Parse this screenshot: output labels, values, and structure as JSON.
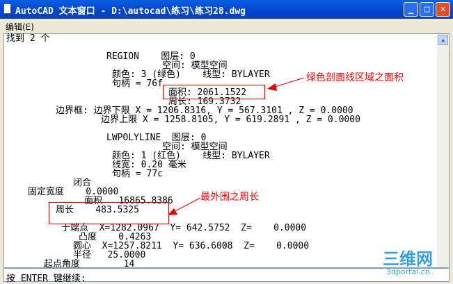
{
  "window": {
    "title": "AutoCAD 文本窗口 - D:\\autocad\\练习\\练习28.dwg",
    "minimize": "_",
    "maximize": "□",
    "close": "✕"
  },
  "menu": {
    "edit": "编辑(E)"
  },
  "lines": [
    "找到 2 个",
    "REGION    图层: 0",
    "空间: 模型空间",
    "颜色: 3 (绿色)    线型: BYLAYER",
    "句柄 = 76f",
    "面积: 2061.1522",
    "周长: 169.3732",
    "边界框: 边界下限 X = 1206.8316, Y = 567.3101 , Z = 0.0000",
    "边界上限 X = 1258.8105, Y = 619.2891 , Z = 0.0000",
    "LWPOLYLINE  图层: 0",
    "空间: 模型空间",
    "颜色: 1 (红色)    线型: BYLAYER",
    "线宽: 0.20 毫米",
    "句柄 = 77c",
    "闭合",
    "固定宽度    0.0000",
    "面积   16865.8386",
    "周长    483.5325",
    "于端点  X=1282.0967  Y= 642.5752  Z=    0.0000",
    "凸度    0.4263",
    "圆心  X=1257.8211  Y= 636.6008  Z=    0.0000",
    "半径   25.0000",
    "起点角度        14"
  ],
  "prompt": "按 ENTER 键继续:",
  "annotations": {
    "area_note": "绿色剖面线区域之面积",
    "perimeter_note": "最外围之周长"
  },
  "watermark": {
    "logo": "三维网",
    "url": "3dportal.cn"
  }
}
